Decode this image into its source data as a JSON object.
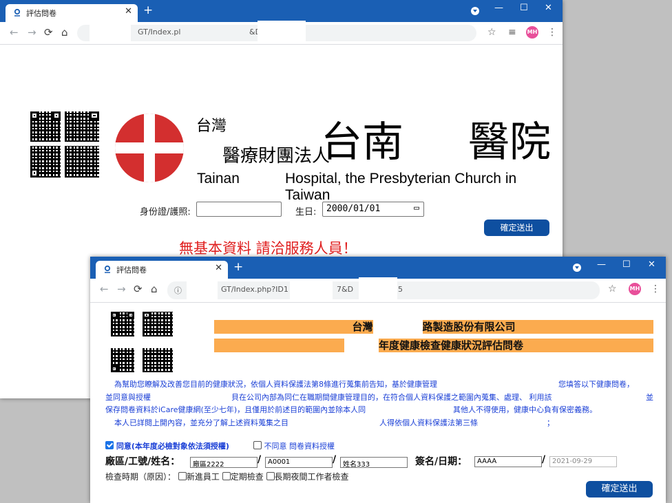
{
  "window1": {
    "tab_title": "評估問卷",
    "url_start": "GT/Index.pl",
    "url_end": "&D",
    "hospital_zh_line1": "台灣",
    "hospital_zh_line2": "醫療財團法人",
    "hospital_big_left": "台南",
    "hospital_big_right": "醫院",
    "hospital_en_left": "Tainan",
    "hospital_en_right": "Hospital, the Presbyterian Church in Taiwan",
    "id_label": "身份證/護照:",
    "id_value": "",
    "birth_label": "生日:",
    "birth_value": "2000/01/01",
    "submit_label": "確定送出",
    "error_message": "無基本資料 請洽服務人員！"
  },
  "window2": {
    "tab_title": "評估問卷",
    "url_start": "GT/Index.php?ID1",
    "url_mid": "7&D",
    "url_end": "5",
    "banner_line1_left": "台灣",
    "banner_line1_right": "路製造股份有限公司",
    "banner_line2": "年度健康檢查健康狀況評估問卷",
    "para1": "為幫助您瞭解及改善您目前的健康狀況，依個人資料保護法第8條進行蒐集前告知，基於健康管理",
    "para1_right": "您填答以下健康問卷，",
    "para2_left": "並同意與授權",
    "para2": "貝在公司內部為同仁在職期間健康管理目的，在符合個人資料保護之範圍內蒐集、處理、 利用該",
    "para2_right": "並",
    "para3": "保存問卷資料於iCare健康網(至少七年)，且僅用於前述目的範圍內並除本人同",
    "para3_right": "其他人不得使用，健康中心負有保密義務。",
    "para4": "本人已詳閱上開內容，並充分了解上述資料蒐集之目",
    "para4_right": "人得依個人資料保護法第三條",
    "para4_end": "；",
    "consent_agree": "同意(本年度必檢對象依法須授權)",
    "consent_disagree": "不同意 問卷資料授權",
    "factory_label": "廠區/工號/姓名：",
    "factory_value": "廠區2222",
    "empno_value": "A0001",
    "name_value": "姓名333",
    "sign_label": "簽名/日期：",
    "sign_value": "AAAA",
    "date_value": "2021-09-29",
    "slash": "/",
    "period_label": "檢查時期（原因）：",
    "period_options": [
      "新進員工",
      "定期檢查",
      "長期夜間工作者檢查"
    ],
    "submit_label": "確定送出"
  },
  "browser": {
    "new_tab": "+",
    "avatar_initials": "MH",
    "minimize": "—",
    "maximize": "☐",
    "close": "✕"
  },
  "colors": {
    "titlebar": "#1a5fb4",
    "error_red": "#e02020",
    "banner_orange": "#fbab4f",
    "button_blue": "#0e4fa0",
    "paragraph_blue": "#1a3fd6"
  }
}
